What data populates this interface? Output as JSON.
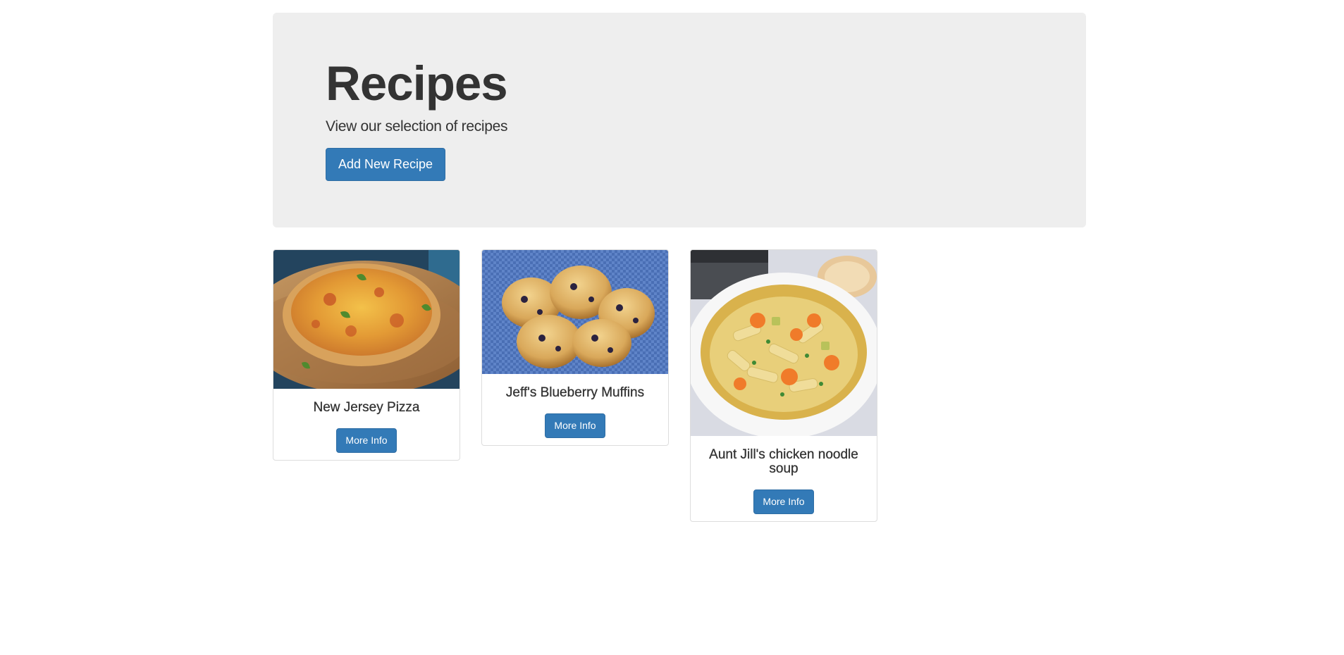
{
  "jumbotron": {
    "title": "Recipes",
    "subtitle": "View our selection of recipes",
    "add_button_label": "Add New Recipe"
  },
  "recipes": [
    {
      "name": "New Jersey Pizza",
      "button_label": "More Info",
      "image": "pizza-photo"
    },
    {
      "name": "Jeff's Blueberry Muffins",
      "button_label": "More Info",
      "image": "blueberry-muffins-photo"
    },
    {
      "name": "Aunt Jill's chicken noodle soup",
      "button_label": "More Info",
      "image": "chicken-noodle-soup-photo"
    }
  ],
  "colors": {
    "primary": "#337ab7",
    "jumbotron_bg": "#eeeeee",
    "text": "#333333"
  }
}
